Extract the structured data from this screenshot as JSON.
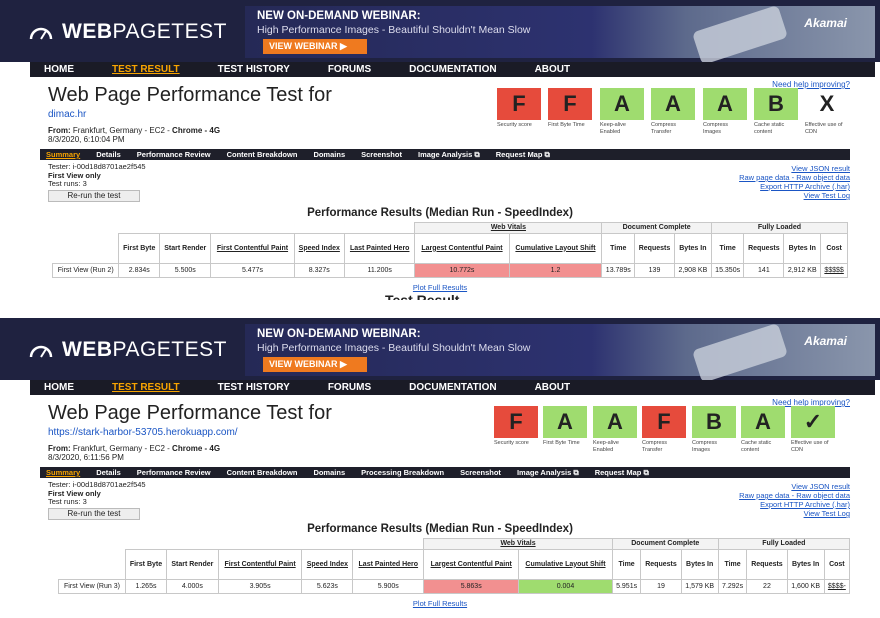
{
  "panels": [
    {
      "logo": {
        "bold": "WEB",
        "rest": "PAGETEST"
      },
      "banner": {
        "line1": "NEW ON-DEMAND WEBINAR:",
        "line2": "High Performance Images - Beautiful Shouldn't Mean Slow",
        "button": "VIEW WEBINAR ▶",
        "brand": "Akamai"
      },
      "nav": [
        "HOME",
        "TEST RESULT",
        "TEST HISTORY",
        "FORUMS",
        "DOCUMENTATION",
        "ABOUT"
      ],
      "title": "Web Page Performance Test for",
      "url": "dimac.hr",
      "from_label": "From:",
      "from_value": "Frankfurt, Germany - EC2 - ",
      "from_browser": "Chrome - 4G",
      "date": "8/3/2020, 6:10:04 PM",
      "help": "Need help improving?",
      "grades": [
        {
          "letter": "F",
          "label": "Security score",
          "color": "#e64b3c"
        },
        {
          "letter": "F",
          "label": "First Byte Time",
          "color": "#e64b3c"
        },
        {
          "letter": "A",
          "label": "Keep-alive Enabled",
          "color": "#9fdc6f"
        },
        {
          "letter": "A",
          "label": "Compress Transfer",
          "color": "#9fdc6f"
        },
        {
          "letter": "A",
          "label": "Compress Images",
          "color": "#9fdc6f"
        },
        {
          "letter": "B",
          "label": "Cache static content",
          "color": "#9fdc6f"
        },
        {
          "letter": "X",
          "label": "Effective use of CDN",
          "color": "transparent"
        }
      ],
      "tabs": [
        "Summary",
        "Details",
        "Performance Review",
        "Content Breakdown",
        "Domains",
        "Screenshot",
        "Image Analysis ⧉",
        "Request Map ⧉"
      ],
      "tester": "Tester: i-00d18d8701ae2f545",
      "first_view": "First View only",
      "test_runs": "Test runs: 3",
      "rerun": "Re-run the test",
      "links": [
        "View JSON result",
        "Raw page data - Raw object data",
        "Export HTTP Archive (.har)",
        "View Test Log"
      ],
      "results_title": "Performance Results (Median Run - SpeedIndex)",
      "row": {
        "label": "First View (Run 2)",
        "first_byte": "2.834s",
        "start_render": "5.500s",
        "fcp": "5.477s",
        "speed_index": "8.327s",
        "lph": "11.200s",
        "lcp": "10.772s",
        "cls": "1.2",
        "dc_time": "13.789s",
        "dc_requests": "139",
        "dc_bytes": "2,908 KB",
        "fl_time": "15.350s",
        "fl_requests": "141",
        "fl_bytes": "2,912 KB",
        "cost": "$$$$$"
      },
      "plot": "Plot Full Results",
      "ghost": "Test Result"
    },
    {
      "logo": {
        "bold": "WEB",
        "rest": "PAGETEST"
      },
      "banner": {
        "line1": "NEW ON-DEMAND WEBINAR:",
        "line2": "High Performance Images - Beautiful Shouldn't Mean Slow",
        "button": "VIEW WEBINAR ▶",
        "brand": "Akamai"
      },
      "nav": [
        "HOME",
        "TEST RESULT",
        "TEST HISTORY",
        "FORUMS",
        "DOCUMENTATION",
        "ABOUT"
      ],
      "title": "Web Page Performance Test for",
      "url": "https://stark-harbor-53705.herokuapp.com/",
      "from_label": "From:",
      "from_value": "Frankfurt, Germany - EC2 - ",
      "from_browser": "Chrome - 4G",
      "date": "8/3/2020, 6:11:56 PM",
      "help": "Need help improving?",
      "grades": [
        {
          "letter": "F",
          "label": "Security score",
          "color": "#e64b3c"
        },
        {
          "letter": "A",
          "label": "First Byte Time",
          "color": "#9fdc6f"
        },
        {
          "letter": "A",
          "label": "Keep-alive Enabled",
          "color": "#9fdc6f"
        },
        {
          "letter": "F",
          "label": "Compress Transfer",
          "color": "#e64b3c"
        },
        {
          "letter": "B",
          "label": "Compress Images",
          "color": "#9fdc6f"
        },
        {
          "letter": "A",
          "label": "Cache static content",
          "color": "#9fdc6f"
        },
        {
          "letter": "✓",
          "label": "Effective use of CDN",
          "color": "#9fdc6f"
        }
      ],
      "tabs": [
        "Summary",
        "Details",
        "Performance Review",
        "Content Breakdown",
        "Domains",
        "Processing Breakdown",
        "Screenshot",
        "Image Analysis ⧉",
        "Request Map ⧉"
      ],
      "tester": "Tester: i-00d18d8701ae2f545",
      "first_view": "First View only",
      "test_runs": "Test runs: 3",
      "rerun": "Re-run the test",
      "links": [
        "View JSON result",
        "Raw page data - Raw object data",
        "Export HTTP Archive (.har)",
        "View Test Log"
      ],
      "results_title": "Performance Results (Median Run - SpeedIndex)",
      "row": {
        "label": "First View (Run 3)",
        "first_byte": "1.265s",
        "start_render": "4.000s",
        "fcp": "3.905s",
        "speed_index": "5.623s",
        "lph": "5.900s",
        "lcp": "5.863s",
        "cls": "0.004",
        "dc_time": "5.951s",
        "dc_requests": "19",
        "dc_bytes": "1,579 KB",
        "fl_time": "7.292s",
        "fl_requests": "22",
        "fl_bytes": "1,600 KB",
        "cost": "$$$$-"
      },
      "plot": "Plot Full Results"
    }
  ],
  "table_headers": {
    "web_vitals": "Web Vitals",
    "document_complete": "Document Complete",
    "fully_loaded": "Fully Loaded",
    "first_byte": "First Byte",
    "start_render": "Start Render",
    "fcp": "First Contentful Paint",
    "speed_index": "Speed Index",
    "lph": "Last Painted Hero",
    "lcp": "Largest Contentful Paint",
    "cls": "Cumulative Layout Shift",
    "time": "Time",
    "requests": "Requests",
    "bytes_in": "Bytes In",
    "cost": "Cost"
  }
}
